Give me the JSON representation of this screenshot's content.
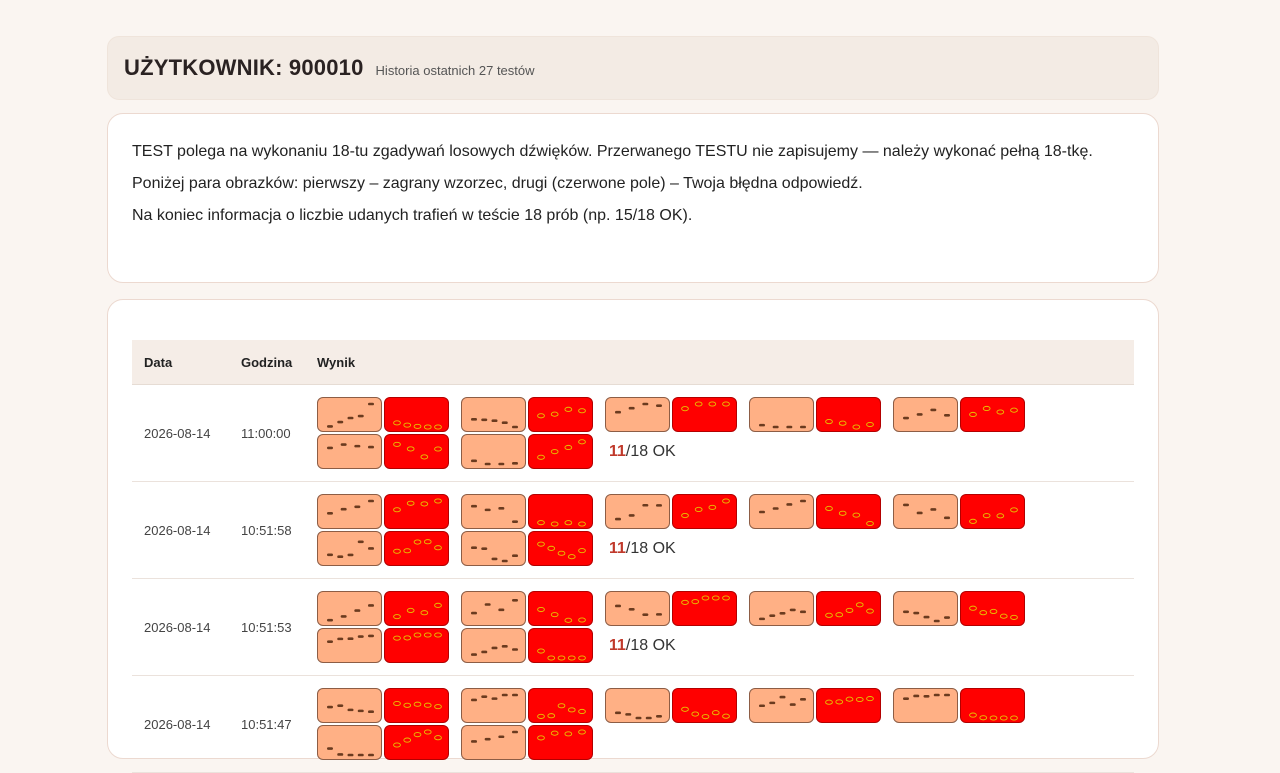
{
  "header": {
    "title": "UŻYTKOWNIK: 900010",
    "subtitle": "Historia ostatnich 27 testów"
  },
  "info": {
    "p1": "TEST polega na wykonaniu 18-tu zgadywań losowych dźwięków. Przerwanego TESTU nie zapisujemy — należy wykonać pełną 18-tkę.",
    "p2": "Poniżej para obrazków: pierwszy – zagrany wzorzec, drugi (czerwone pole) – Twoja błędna odpowiedź.",
    "p3": "Na koniec informacja o liczbie udanych trafień w teście 18 prób (np. 15/18 OK)."
  },
  "table": {
    "headers": {
      "date": "Data",
      "time": "Godzina",
      "result": "Wynik"
    },
    "rows": [
      {
        "date": "2026-08-14",
        "time": "11:00:00",
        "ok": "11",
        "total": "/18 OK"
      },
      {
        "date": "2026-08-14",
        "time": "10:51:58",
        "ok": "11",
        "total": "/18 OK"
      },
      {
        "date": "2026-08-14",
        "time": "10:51:53",
        "ok": "11",
        "total": "/18 OK"
      },
      {
        "date": "2026-08-14",
        "time": "10:51:47",
        "ok": "",
        "total": ""
      }
    ]
  },
  "colors": {
    "pattern_tile": "#ffb085",
    "answer_tile": "#ff0000",
    "accent_ok": "#c0392b"
  }
}
